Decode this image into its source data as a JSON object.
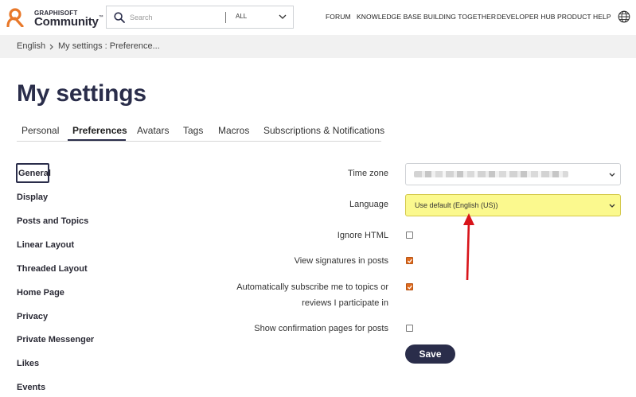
{
  "header": {
    "logo_small": "GRAPHISOFT",
    "logo_big": "Community",
    "logo_trademark": "™",
    "search_placeholder": "Search",
    "search_scope": "ALL",
    "nav": [
      "FORUM",
      "KNOWLEDGE BASE",
      "BUILDING TOGETHER",
      "DEVELOPER HUB",
      "PRODUCT HELP"
    ],
    "brand_color": "#e8782a"
  },
  "breadcrumb": {
    "items": [
      "English",
      "My settings : Preference..."
    ]
  },
  "page": {
    "title": "My settings"
  },
  "tabs": [
    {
      "label": "Personal"
    },
    {
      "label": "Preferences",
      "active": true
    },
    {
      "label": "Avatars"
    },
    {
      "label": "Tags"
    },
    {
      "label": "Macros"
    },
    {
      "label": "Subscriptions & Notifications"
    }
  ],
  "sidebar": {
    "items": [
      "General",
      "Display",
      "Posts and Topics",
      "Linear Layout",
      "Threaded Layout",
      "Home Page",
      "Privacy",
      "Private Messenger",
      "Likes",
      "Events"
    ],
    "active": "General"
  },
  "form": {
    "time_zone_label": "Time zone",
    "language_label": "Language",
    "language_value": "Use default (English (US))",
    "ignore_html_label": "Ignore HTML",
    "ignore_html_checked": false,
    "view_signatures_label": "View signatures in posts",
    "view_signatures_checked": true,
    "auto_subscribe_label": "Automatically subscribe me to topics or reviews I participate in",
    "auto_subscribe_checked": true,
    "show_confirmation_label": "Show confirmation pages for posts",
    "show_confirmation_checked": false,
    "save_label": "Save",
    "highlight_color": "#fbf98e",
    "annotation_arrow_color": "#d8141a"
  }
}
